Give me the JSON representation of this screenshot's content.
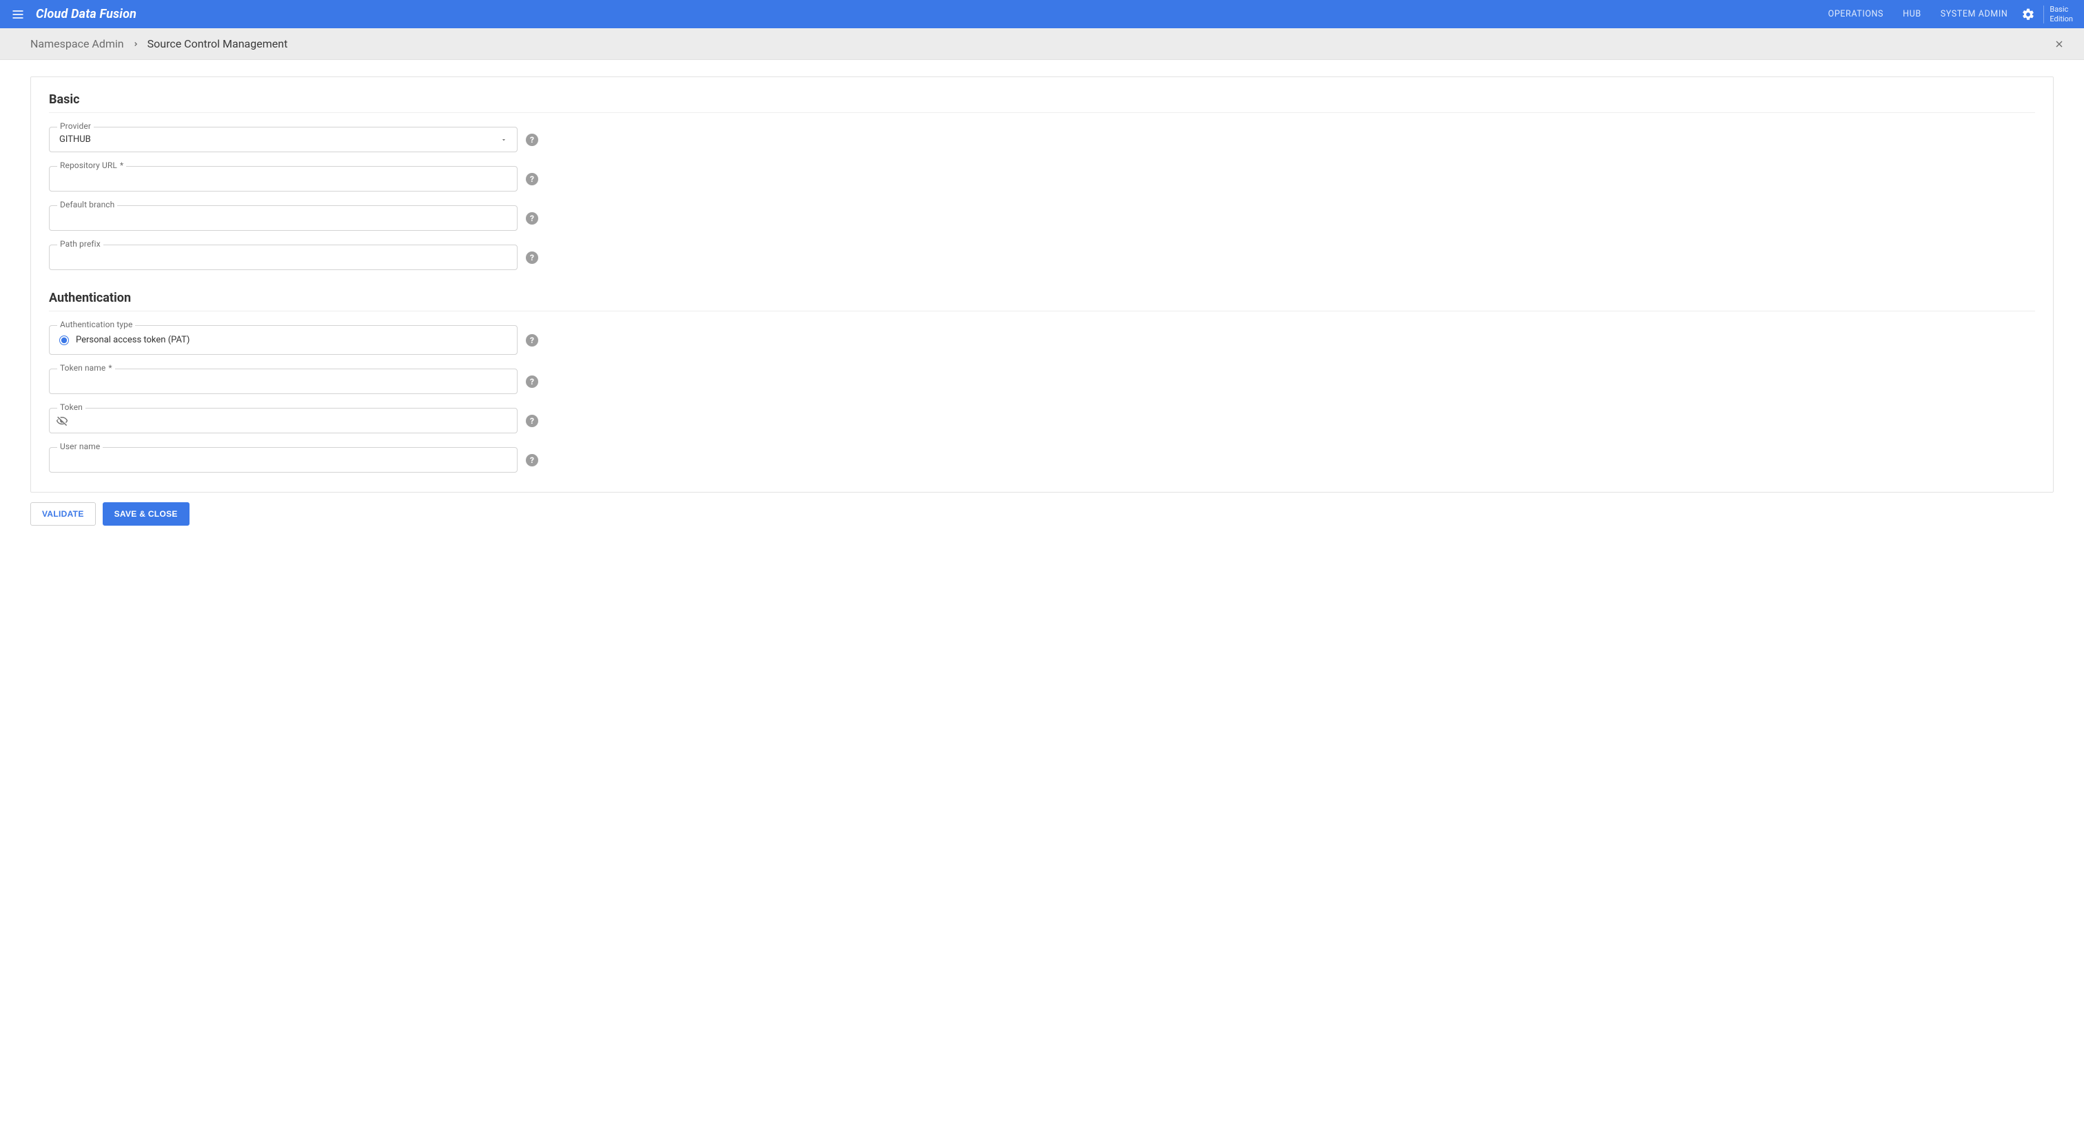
{
  "appbar": {
    "brand": "Cloud Data Fusion",
    "nav": {
      "operations": "OPERATIONS",
      "hub": "HUB",
      "systemAdmin": "SYSTEM ADMIN"
    },
    "edition_line1": "Basic",
    "edition_line2": "Edition"
  },
  "breadcrumb": {
    "parent": "Namespace Admin",
    "current": "Source Control Management"
  },
  "sections": {
    "basic": {
      "title": "Basic",
      "provider": {
        "label": "Provider",
        "value": "GITHUB"
      },
      "repoUrl": {
        "label": "Repository URL",
        "required": "*",
        "value": ""
      },
      "defaultBranch": {
        "label": "Default branch",
        "value": ""
      },
      "pathPrefix": {
        "label": "Path prefix",
        "value": ""
      }
    },
    "auth": {
      "title": "Authentication",
      "authType": {
        "label": "Authentication type",
        "option": "Personal access token (PAT)"
      },
      "tokenName": {
        "label": "Token name",
        "required": "*",
        "value": ""
      },
      "token": {
        "label": "Token",
        "value": ""
      },
      "userName": {
        "label": "User name",
        "value": ""
      }
    }
  },
  "buttons": {
    "validate": "VALIDATE",
    "save": "SAVE & CLOSE"
  },
  "glyphs": {
    "help": "?"
  }
}
